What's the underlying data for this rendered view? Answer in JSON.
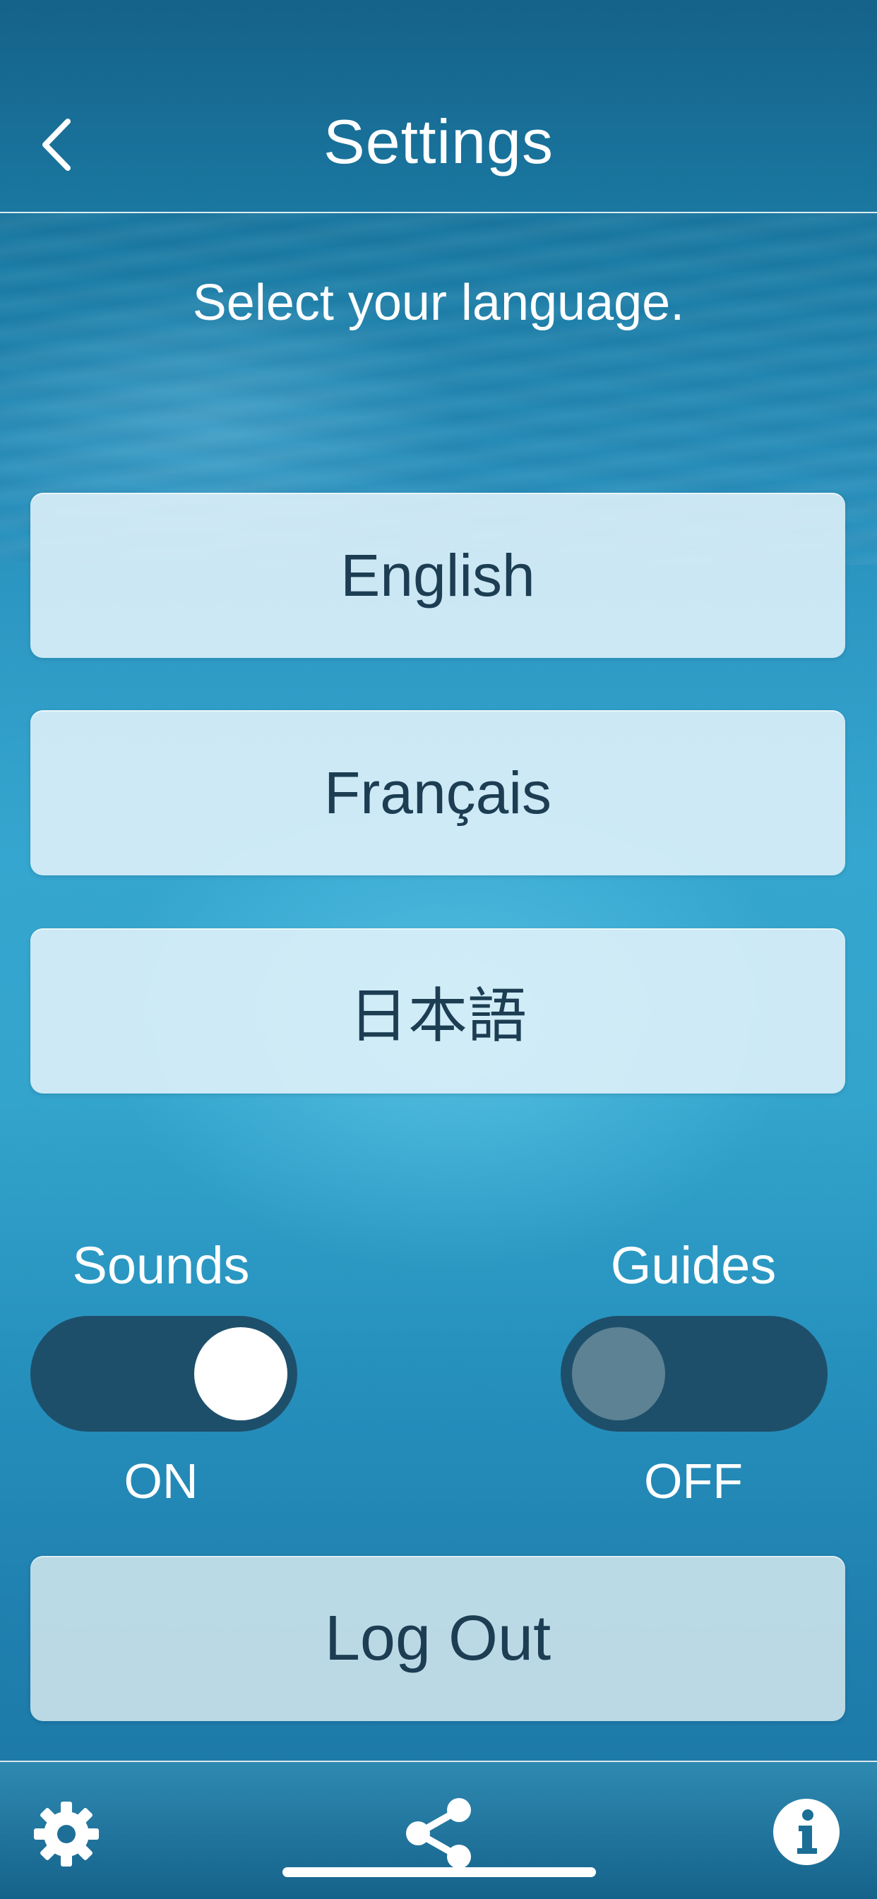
{
  "header": {
    "title": "Settings",
    "back_icon": "chevron-left-icon"
  },
  "prompt": "Select your language.",
  "languages": [
    {
      "label": "English"
    },
    {
      "label": "Français"
    },
    {
      "label": "日本語"
    }
  ],
  "toggles": {
    "sounds": {
      "label": "Sounds",
      "state": "ON",
      "on": true
    },
    "guides": {
      "label": "Guides",
      "state": "OFF",
      "on": false
    }
  },
  "logout_label": "Log Out",
  "tabbar": {
    "items": [
      {
        "icon": "gear-icon"
      },
      {
        "icon": "share-icon"
      },
      {
        "icon": "info-icon"
      }
    ]
  },
  "colors": {
    "text_dark": "#1c3d52",
    "toggle_track": "#1e4f6a",
    "knob_on": "#ffffff",
    "knob_off": "#5c8294"
  }
}
